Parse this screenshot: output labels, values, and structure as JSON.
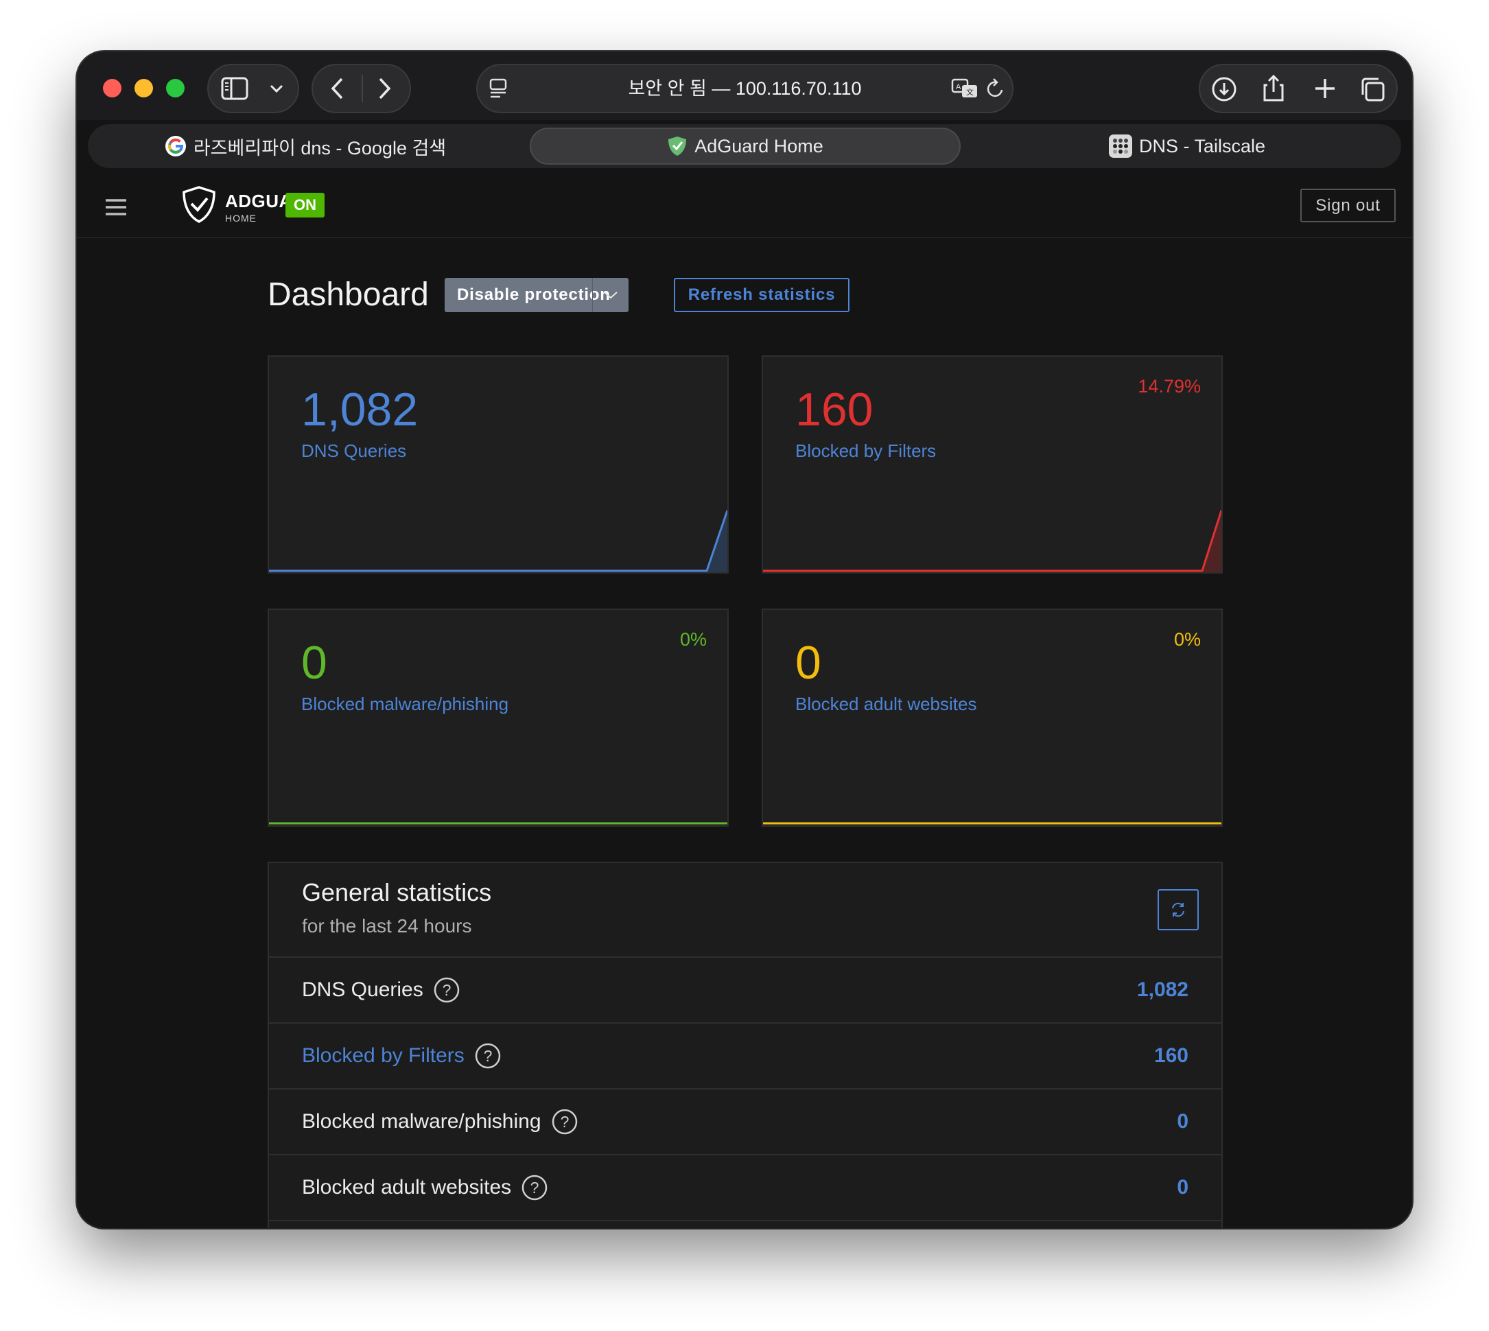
{
  "browser": {
    "address": "보안 안 됨 — 100.116.70.110",
    "tabs": [
      {
        "title": "라즈베리파이 dns - Google 검색",
        "favicon": "google-icon"
      },
      {
        "title": "AdGuard Home",
        "favicon": "adguard-shield-icon",
        "active": true
      },
      {
        "title": "DNS - Tailscale",
        "favicon": "tailscale-icon"
      }
    ]
  },
  "header": {
    "brand_name": "ADGUARD",
    "brand_sub": "HOME",
    "status_badge": "ON",
    "sign_out": "Sign out"
  },
  "dashboard": {
    "title": "Dashboard",
    "disable_protection": "Disable protection",
    "refresh_statistics": "Refresh statistics"
  },
  "cards": [
    {
      "value": "1,082",
      "label": "DNS Queries",
      "percent": "",
      "color": "#4d84d6"
    },
    {
      "value": "160",
      "label": "Blocked by Filters",
      "percent": "14.79%",
      "color": "#e03131"
    },
    {
      "value": "0",
      "label": "Blocked malware/phishing",
      "percent": "0%",
      "color": "#5fb82a"
    },
    {
      "value": "0",
      "label": "Blocked adult websites",
      "percent": "0%",
      "color": "#f2bd0d"
    }
  ],
  "general_stats": {
    "title": "General statistics",
    "subtitle": "for the last 24 hours",
    "rows": [
      {
        "name": "DNS Queries",
        "value": "1,082"
      },
      {
        "name": "Blocked by Filters",
        "value": "160"
      },
      {
        "name": "Blocked malware/phishing",
        "value": "0"
      },
      {
        "name": "Blocked adult websites",
        "value": "0"
      }
    ]
  }
}
